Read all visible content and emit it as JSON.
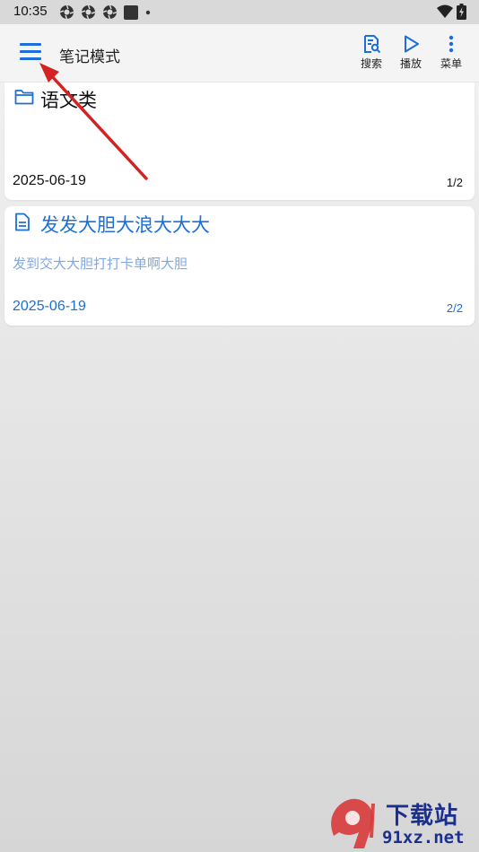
{
  "status_bar": {
    "time": "10:35"
  },
  "app_bar": {
    "title": "笔记模式",
    "actions": [
      {
        "label": "搜索",
        "icon": "search-note-icon"
      },
      {
        "label": "播放",
        "icon": "play-icon"
      },
      {
        "label": "菜单",
        "icon": "more-vert-icon"
      }
    ]
  },
  "notes": [
    {
      "type": "folder",
      "icon": "folder-icon",
      "title": "语文类",
      "description": "",
      "date": "2025-06-19",
      "count": "1/2",
      "title_color": "#111111",
      "date_color": "#111111"
    },
    {
      "type": "note",
      "icon": "document-icon",
      "title": "发发大胆大浪大大大",
      "description": "发到交大大胆打打卡单啊大胆",
      "date": "2025-06-19",
      "count": "2/2",
      "title_color": "#1c6fd9",
      "date_color": "#1c6fd9"
    }
  ],
  "colors": {
    "accent": "#1c6fd9",
    "annotation_arrow": "#d42222"
  },
  "watermark": {
    "brand": "下载站",
    "logo_text": "9",
    "url": "91xz.net"
  }
}
